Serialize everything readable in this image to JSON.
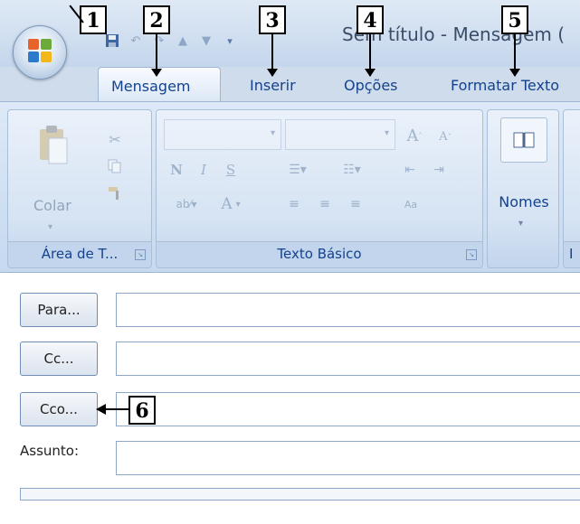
{
  "window": {
    "title": "Sem título - Mensagem ("
  },
  "qat": {
    "icons": [
      "save-icon",
      "undo-icon",
      "redo-icon",
      "up-arrow-icon",
      "down-arrow-icon",
      "customize-icon"
    ]
  },
  "tabs": [
    {
      "label": "Mensagem",
      "active": true
    },
    {
      "label": "Inserir",
      "active": false
    },
    {
      "label": "Opções",
      "active": false
    },
    {
      "label": "Formatar Texto",
      "active": false
    }
  ],
  "ribbon": {
    "clipboard": {
      "paste_label": "Colar",
      "group_label": "Área de T..."
    },
    "basic_text": {
      "bold": "N",
      "italic": "I",
      "underline": "S",
      "font_grow": "A",
      "font_shrink": "A",
      "font_color": "A",
      "group_label": "Texto Básico"
    },
    "names": {
      "label": "Nomes"
    },
    "next_group_letter": "I"
  },
  "form": {
    "to_button": "Para...",
    "cc_button": "Cc...",
    "bcc_button": "Cco...",
    "subject_label": "Assunto:"
  },
  "callouts": [
    "1",
    "2",
    "3",
    "4",
    "5",
    "6"
  ],
  "colors": {
    "accent": "#15428b",
    "ribbon_bg": "#c6d9ef",
    "tab_text": "#15428b"
  }
}
